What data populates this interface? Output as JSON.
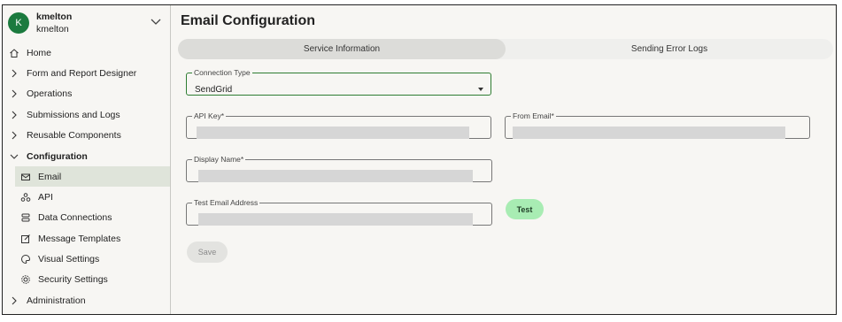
{
  "user": {
    "avatar_letter": "K",
    "name": "kmelton",
    "subname": "kmelton"
  },
  "nav": {
    "home": "Home",
    "form_report_designer": "Form and Report Designer",
    "operations": "Operations",
    "submissions_logs": "Submissions and Logs",
    "reusable_components": "Reusable Components",
    "configuration": "Configuration",
    "email": "Email",
    "api": "API",
    "data_connections": "Data Connections",
    "message_templates": "Message Templates",
    "visual_settings": "Visual Settings",
    "security_settings": "Security Settings",
    "administration": "Administration"
  },
  "page": {
    "title": "Email Configuration"
  },
  "tabs": {
    "service_information": "Service Information",
    "sending_error_logs": "Sending Error Logs"
  },
  "form": {
    "connection_type": {
      "label": "Connection Type",
      "value": "SendGrid"
    },
    "api_key": {
      "label": "API Key*"
    },
    "from_email": {
      "label": "From Email*"
    },
    "display_name": {
      "label": "Display Name*"
    },
    "test_email": {
      "label": "Test Email Address"
    },
    "test_button": "Test",
    "save_button": "Save"
  },
  "colors": {
    "accent": "#1b7a3e",
    "test_button": "#a8ecb3",
    "active_nav": "#dfe4da"
  }
}
